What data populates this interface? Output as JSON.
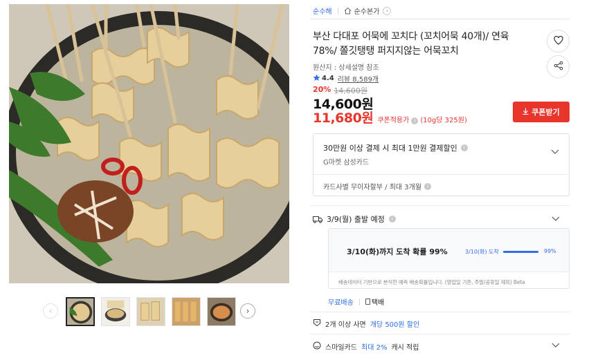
{
  "breadcrumb": {
    "seller": "순수해",
    "store_link": "순수본가"
  },
  "product": {
    "title": "부산 다대포 어묵에 꼬치다 (꼬치어묵 40개)/ 연육 78%/ 쫄깃탱탱 퍼지지않는 어묵꼬치",
    "origin": "원산지 : 상세설명 참조",
    "rating": "4.4",
    "reviews": "리뷰 8,589개",
    "discount_pct": "20%",
    "original_price": "14,600원",
    "price": "14,600원",
    "coupon_price": "11,680원",
    "coupon_label": "쿠폰적용가",
    "unit_price": "(10g당 325원)",
    "coupon_button": "쿠폰받기"
  },
  "payment": {
    "headline": "30만원 이상 결제 시 최대 1만원 결제할인",
    "card_name": "G마켓 삼성카드",
    "installment": "카드사별 무이자할부 / 최대 3개월"
  },
  "shipping": {
    "departure": "3/9(월) 출발 예정",
    "arrival_headline": "3/10(화)까지 도착 확률 99%",
    "arrival_mini_label": "3/10(화) 도착",
    "arrival_pct_label": "99%",
    "arrival_probability": 0.99,
    "note": "배송데이터 기반으로 분석한 예측 배송확률입니다. (영업일 기준, 주말/공휴일 제외) Beta",
    "free_shipping": "무료배송",
    "courier": "택배"
  },
  "promo": {
    "prefix": "2개 이상 사면",
    "highlight": "개당 500원 할인"
  },
  "smilecard": {
    "prefix": "스마일카드",
    "highlight": "최대 2%",
    "suffix": "캐시 적립"
  },
  "icons": {
    "wishlist": "heart-icon",
    "share": "share-icon",
    "star": "star-icon",
    "truck": "truck-icon",
    "tag": "coupon-tag-icon",
    "smile": "smile-card-icon"
  },
  "colors": {
    "accent_red": "#e8352c",
    "accent_blue": "#2f6ee6"
  }
}
